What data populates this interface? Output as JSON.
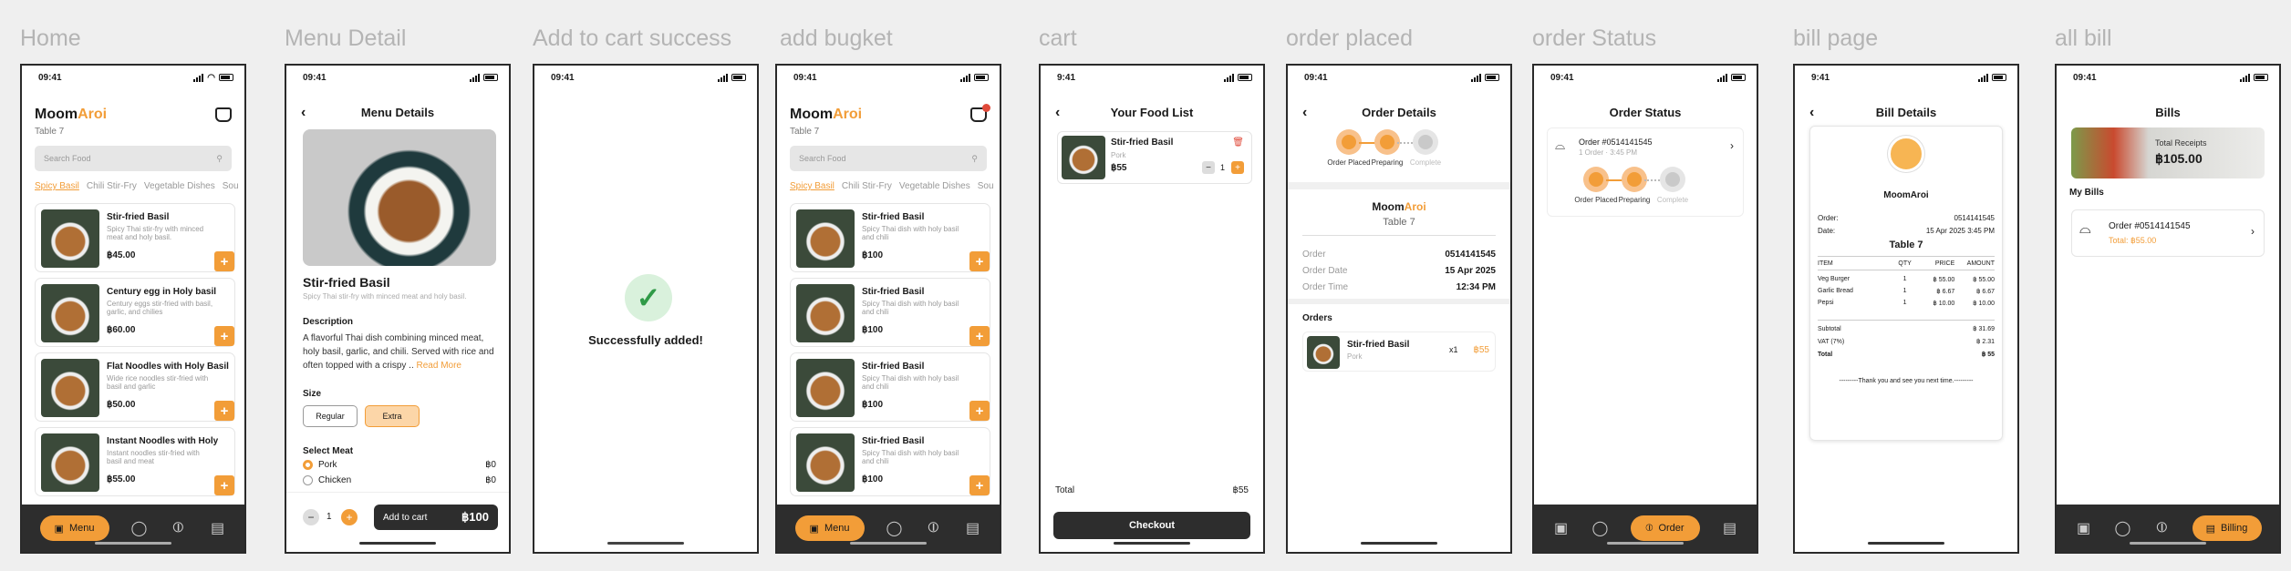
{
  "screens": [
    {
      "label": "Home"
    },
    {
      "label": "Menu Detail"
    },
    {
      "label": "Add to cart success"
    },
    {
      "label": "add bugket"
    },
    {
      "label": "cart"
    },
    {
      "label": "order placed"
    },
    {
      "label": "order Status"
    },
    {
      "label": "bill page"
    },
    {
      "label": "all bill"
    }
  ],
  "time": "09:41",
  "time_alt": "9:41",
  "brand": {
    "a": "Moom",
    "b": "Aroi"
  },
  "table": "Table 7",
  "search_placeholder": "Search Food",
  "cats": [
    "Spicy Basil",
    "Chili Stir-Fry",
    "Vegetable Dishes",
    "Sou"
  ],
  "home_items": [
    {
      "name": "Stir-fried Basil",
      "desc": "Spicy Thai stir-fry with minced meat and holy basil.",
      "price": "฿45.00"
    },
    {
      "name": "Century egg in Holy basil",
      "desc": "Century eggs stir-fried with basil, garlic, and chilies",
      "price": "฿60.00"
    },
    {
      "name": "Flat Noodles with Holy Basil",
      "desc": "Wide rice noodles stir-fried with basil and garlic",
      "price": "฿50.00"
    },
    {
      "name": "Instant Noodles with Holy",
      "desc": "Instant noodles stir-fried with basil and meat",
      "price": "฿55.00"
    }
  ],
  "basket_item": {
    "name": "Stir-fried Basil",
    "desc": "Spicy Thai dish with holy basil and chili",
    "price": "฿100"
  },
  "nav": {
    "menu": "Menu",
    "order": "Order",
    "billing": "Billing"
  },
  "detail": {
    "title": "Menu Details",
    "name": "Stir-fried Basil",
    "sub": "Spicy Thai stir-fry with minced meat and holy basil.",
    "desc_h": "Description",
    "desc": "A flavorful Thai dish combining minced meat, holy basil, garlic, and chili. Served with rice and often topped with a crispy ..",
    "read_more": "Read More",
    "size_h": "Size",
    "size_regular": "Regular",
    "size_extra": "Extra",
    "meat_h": "Select Meat",
    "meats": [
      {
        "name": "Pork",
        "price": "฿0"
      },
      {
        "name": "Chicken",
        "price": "฿0"
      }
    ],
    "qty": "1",
    "add": "Add to cart",
    "total": "฿100"
  },
  "success": "Successfully added!",
  "cart": {
    "title": "Your Food List",
    "name": "Stir-fried Basil",
    "meat": "Pork",
    "price": "฿55",
    "qty": "1",
    "total_label": "Total",
    "total": "฿55",
    "checkout": "Checkout"
  },
  "order": {
    "title": "Order Details",
    "steps": [
      "Order Placed",
      "Preparing",
      "Complete"
    ],
    "order_label": "Order",
    "order_no": "0514141545",
    "date_label": "Order Date",
    "date": "15 Apr 2025",
    "time_label": "Order Time",
    "time": "12:34 PM",
    "orders_h": "Orders",
    "item": "Stir-fried Basil",
    "meat": "Pork",
    "qty": "x1",
    "price": "฿55"
  },
  "status": {
    "title": "Order Status",
    "order": "Order #0514141545",
    "sub": "1 Order · 3:45 PM"
  },
  "bill": {
    "title": "Bill Details",
    "brand": "MoomAroi",
    "order_label": "Order:",
    "order": "0514141545",
    "date_label": "Date:",
    "date": "15 Apr 2025 3:45 PM",
    "table": "Table 7",
    "cols": [
      "ITEM",
      "QTY",
      "PRICE",
      "AMOUNT"
    ],
    "rows": [
      [
        "Veg Burger",
        "1",
        "฿ 55.00",
        "฿ 55.00"
      ],
      [
        "Garlic Bread",
        "1",
        "฿ 6.67",
        "฿ 6.67"
      ],
      [
        "Pepsi",
        "1",
        "฿ 10.00",
        "฿ 10.00"
      ]
    ],
    "subtotal_label": "Subtotal",
    "subtotal": "฿ 31.69",
    "vat_label": "VAT (7%)",
    "vat": "฿ 2.31",
    "total_label": "Total",
    "total": "฿ 55",
    "thanks": "---------Thank you and see you next time.---------"
  },
  "bills": {
    "title": "Bills",
    "receipts_label": "Total Receipts",
    "receipts": "฿105.00",
    "my": "My Bills",
    "order": "Order #0514141545",
    "total": "Total: ฿55.00"
  }
}
